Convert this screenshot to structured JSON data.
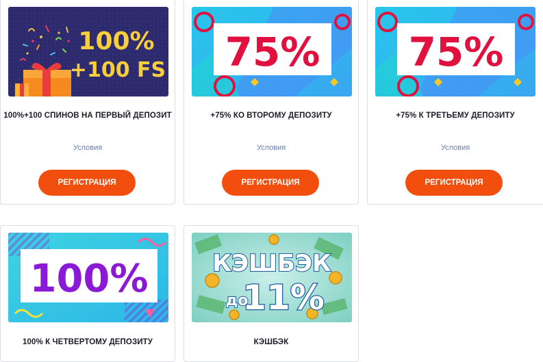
{
  "bonuses": [
    {
      "banner_line1": "100%",
      "banner_line2": "+100 FS",
      "title": "100%+100 СПИНОВ НА ПЕРВЫЙ ДЕПОЗИТ",
      "terms": "Условия",
      "button": "РЕГИСТРАЦИЯ"
    },
    {
      "banner_text": "75%",
      "title": "+75% КО ВТОРОМУ ДЕПОЗИТУ",
      "terms": "Условия",
      "button": "РЕГИСТРАЦИЯ"
    },
    {
      "banner_text": "75%",
      "title": "+75% К ТРЕТЬЕМУ ДЕПОЗИТУ",
      "terms": "Условия",
      "button": "РЕГИСТРАЦИЯ"
    },
    {
      "banner_text": "100%",
      "title": "100% К ЧЕТВЕРТОМУ ДЕПОЗИТУ"
    },
    {
      "banner_line1": "КЭШБЭК",
      "banner_do": "до",
      "banner_line2": "11%",
      "title": "КЭШБЭК"
    }
  ],
  "colors": {
    "button": "#f24f0f",
    "terms_link": "#6a7ea8",
    "purple_banner": "#2e2a6e",
    "accent_red": "#e0113f",
    "accent_violet": "#8a1ad6",
    "accent_cyan": "#1fc2e6"
  }
}
